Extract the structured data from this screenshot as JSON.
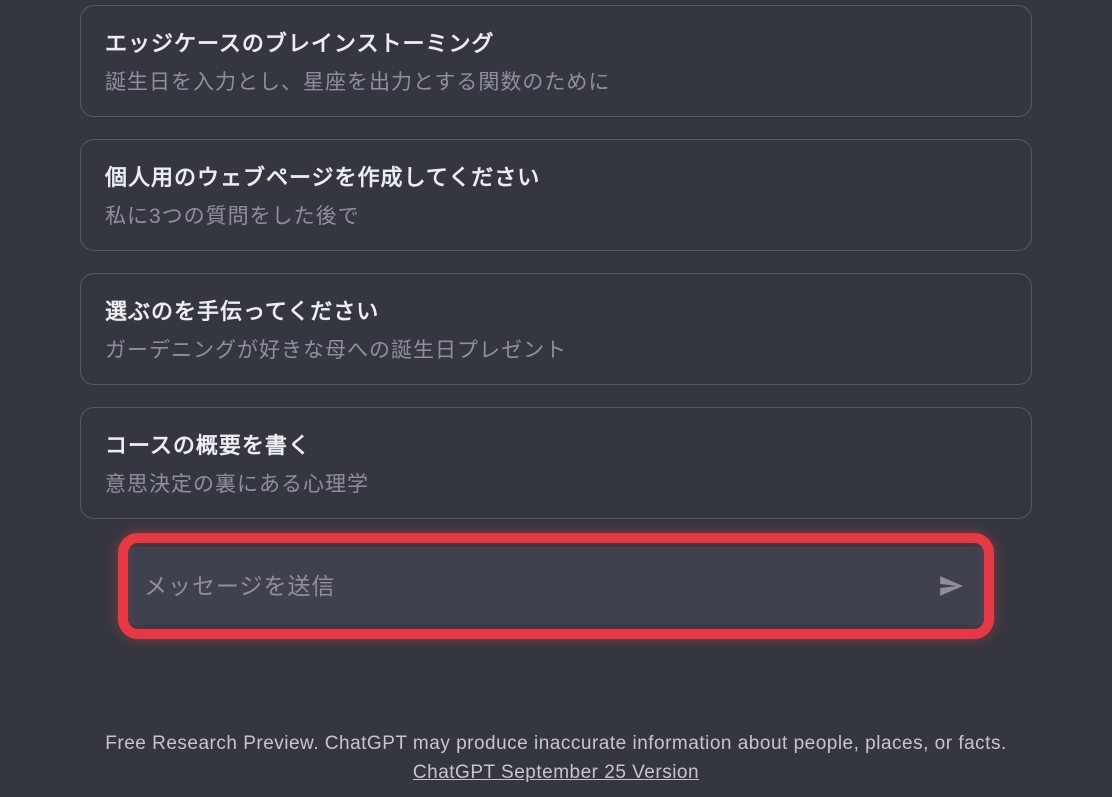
{
  "suggestions": [
    {
      "title": "エッジケースのブレインストーミング",
      "subtitle": "誕生日を入力とし、星座を出力とする関数のために"
    },
    {
      "title": "個人用のウェブページを作成してください",
      "subtitle": "私に3つの質問をした後で"
    },
    {
      "title": "選ぶのを手伝ってください",
      "subtitle": "ガーデニングが好きな母への誕生日プレゼント"
    },
    {
      "title": "コースの概要を書く",
      "subtitle": "意思決定の裏にある心理学"
    }
  ],
  "input": {
    "placeholder": "メッセージを送信"
  },
  "footer": {
    "text_before": "Free Research Preview. ChatGPT may produce inaccurate information about people, places, or facts. ",
    "link_text": "ChatGPT September 25 Version"
  }
}
